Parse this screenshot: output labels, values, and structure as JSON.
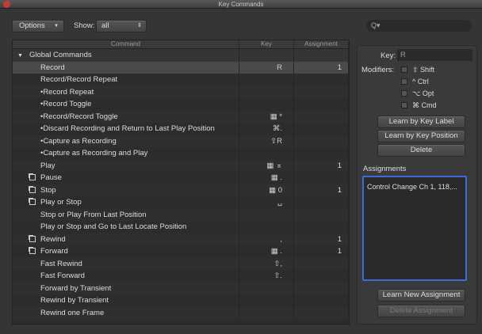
{
  "window": {
    "title": "Key Commands"
  },
  "toolbar": {
    "options_label": "Options",
    "show_label": "Show:",
    "show_value": "all",
    "search_placeholder": "Q▾"
  },
  "table": {
    "headers": [
      "Command",
      "Key",
      "Assignment"
    ],
    "group": "Global Commands",
    "rows": [
      {
        "command": "Record",
        "key": "R",
        "assignment": "1",
        "selected": true
      },
      {
        "command": "Record/Record Repeat",
        "key": "",
        "assignment": ""
      },
      {
        "command": "•Record Repeat",
        "key": "",
        "assignment": ""
      },
      {
        "command": "•Record Toggle",
        "key": "",
        "assignment": ""
      },
      {
        "command": "•Record/Record Toggle",
        "key": "▦ *",
        "assignment": ""
      },
      {
        "command": "•Discard Recording and Return to Last Play Position",
        "key": "⌘.",
        "assignment": ""
      },
      {
        "command": "•Capture as Recording",
        "key": "⇧R",
        "assignment": ""
      },
      {
        "command": "•Capture as Recording and Play",
        "key": "",
        "assignment": ""
      },
      {
        "command": "Play",
        "key": "▦ ⌅",
        "assignment": "1"
      },
      {
        "command": "Pause",
        "key": "▦ .",
        "assignment": "",
        "icon": true
      },
      {
        "command": "Stop",
        "key": "▦ 0",
        "assignment": "1",
        "icon": true
      },
      {
        "command": "Play or Stop",
        "key": "␣",
        "assignment": "",
        "icon": true
      },
      {
        "command": "Stop or Play From Last Position",
        "key": "",
        "assignment": ""
      },
      {
        "command": "Play or Stop and Go to Last Locate Position",
        "key": "",
        "assignment": ""
      },
      {
        "command": "Rewind",
        "key": ",",
        "assignment": "1",
        "icon": true
      },
      {
        "command": "Forward",
        "key": "▦ .",
        "assignment": "1",
        "icon": true
      },
      {
        "command": "Fast Rewind",
        "key": "⇧,",
        "assignment": ""
      },
      {
        "command": "Fast Forward",
        "key": "⇧.",
        "assignment": ""
      },
      {
        "command": "Forward by Transient",
        "key": "",
        "assignment": ""
      },
      {
        "command": "Rewind by Transient",
        "key": "",
        "assignment": ""
      },
      {
        "command": "Rewind one Frame",
        "key": "",
        "assignment": ""
      }
    ]
  },
  "panel": {
    "key_label": "Key:",
    "key_value": "R",
    "modifiers_label": "Modifiers:",
    "modifiers": [
      "⇧ Shift",
      "^ Ctrl",
      "⌥ Opt",
      "⌘ Cmd"
    ],
    "learn_key_label": "Learn by Key Label",
    "learn_key_position": "Learn by Key Position",
    "delete": "Delete",
    "assignments_label": "Assignments",
    "assignments": [
      "Control Change Ch 1, 118,..."
    ],
    "learn_new": "Learn New Assignment",
    "delete_assignment": "Delete Assignment"
  },
  "colors": {
    "selection_border": "#3d6bd8",
    "close_button": "#c83a2e"
  }
}
